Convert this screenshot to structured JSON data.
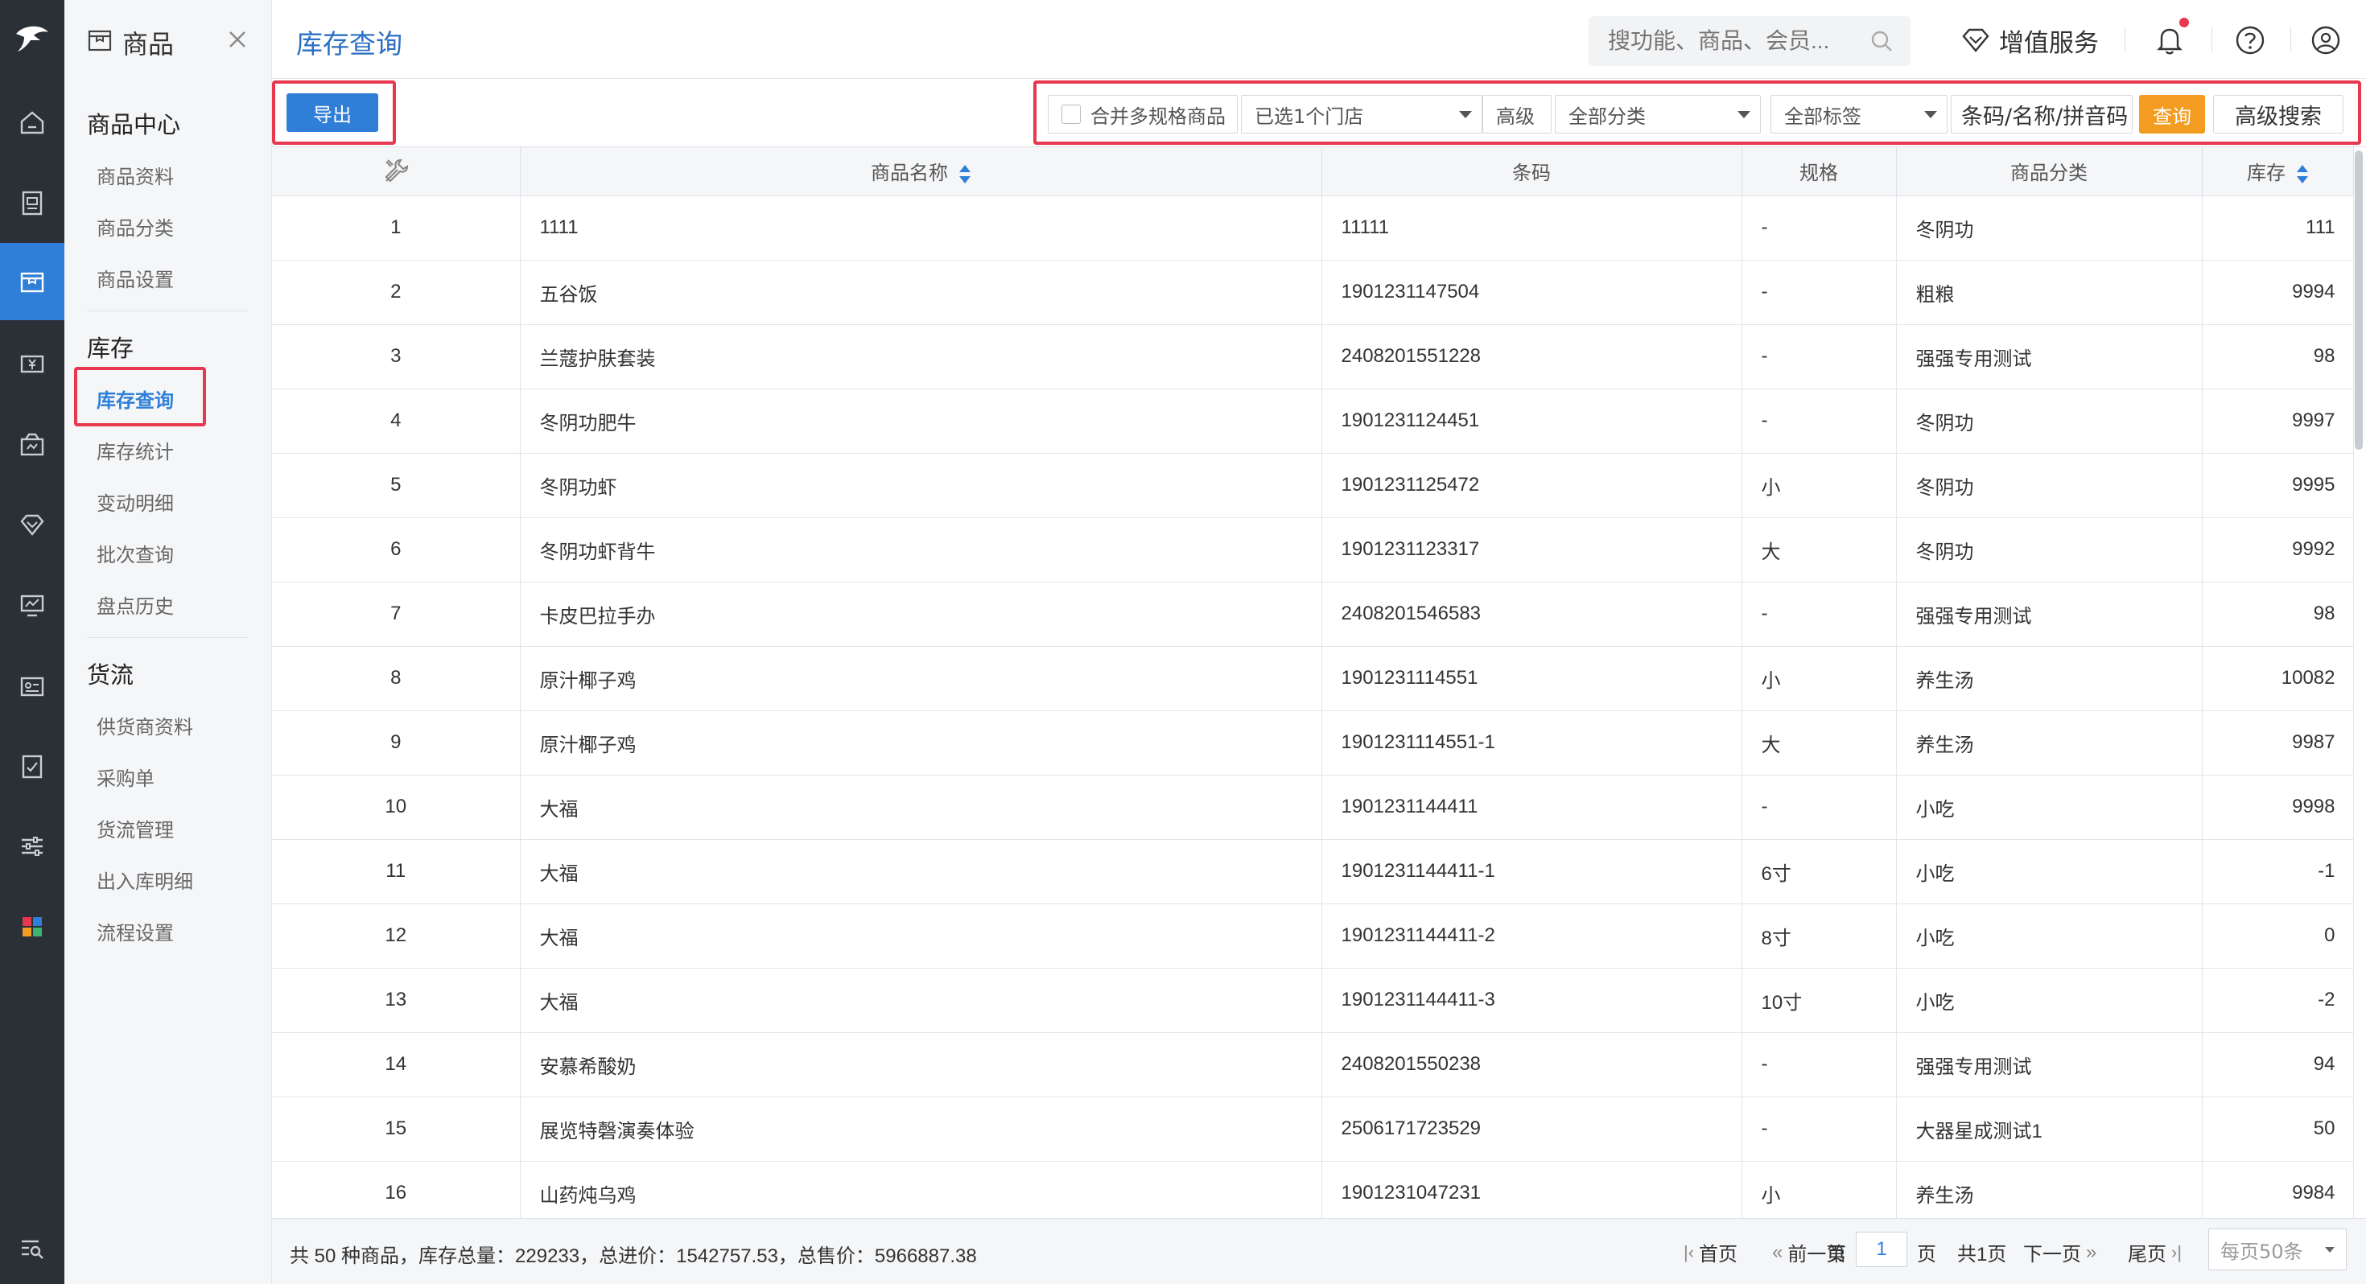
{
  "rail": {
    "items": [
      "home-icon",
      "ledger-icon",
      "product-icon",
      "cash-icon",
      "member-icon",
      "diamond-icon",
      "monitor-icon",
      "card-icon",
      "report-icon",
      "sliders-icon",
      "apps-icon"
    ],
    "active_index": 2,
    "bottom": "search-menu-icon"
  },
  "sidebar": {
    "title": "商品",
    "groups": [
      {
        "label": "商品中心",
        "items": [
          "商品资料",
          "商品分类",
          "商品设置"
        ]
      },
      {
        "label": "库存",
        "items": [
          "库存查询",
          "库存统计",
          "变动明细",
          "批次查询",
          "盘点历史"
        ]
      },
      {
        "label": "货流",
        "items": [
          "供货商资料",
          "采购单",
          "货流管理",
          "出入库明细",
          "流程设置"
        ]
      }
    ],
    "active_item": "库存查询"
  },
  "header": {
    "title": "库存查询",
    "search_placeholder": "搜功能、商品、会员...",
    "vip_label": "增值服务"
  },
  "toolbar": {
    "export_label": "导出",
    "merge_label": "合并多规格商品",
    "store_select": "已选1个门店",
    "advanced_label": "高级",
    "category_select": "全部分类",
    "tag_select": "全部标签",
    "code_search": "条码/名称/拼音码",
    "query_label": "查询",
    "advanced_search_label": "高级搜索"
  },
  "table": {
    "columns": [
      "",
      "商品名称",
      "条码",
      "规格",
      "商品分类",
      "库存"
    ],
    "rows": [
      [
        "1",
        "1111",
        "11111",
        "-",
        "冬阴功",
        "111"
      ],
      [
        "2",
        "五谷饭",
        "1901231147504",
        "-",
        "粗粮",
        "9994"
      ],
      [
        "3",
        "兰蔻护肤套装",
        "2408201551228",
        "-",
        "强强专用测试",
        "98"
      ],
      [
        "4",
        "冬阴功肥牛",
        "1901231124451",
        "-",
        "冬阴功",
        "9997"
      ],
      [
        "5",
        "冬阴功虾",
        "1901231125472",
        "小",
        "冬阴功",
        "9995"
      ],
      [
        "6",
        "冬阴功虾背牛",
        "1901231123317",
        "大",
        "冬阴功",
        "9992"
      ],
      [
        "7",
        "卡皮巴拉手办",
        "2408201546583",
        "-",
        "强强专用测试",
        "98"
      ],
      [
        "8",
        "原汁椰子鸡",
        "1901231114551",
        "小",
        "养生汤",
        "10082"
      ],
      [
        "9",
        "原汁椰子鸡",
        "1901231114551-1",
        "大",
        "养生汤",
        "9987"
      ],
      [
        "10",
        "大福",
        "1901231144411",
        "-",
        "小吃",
        "9998"
      ],
      [
        "11",
        "大福",
        "1901231144411-1",
        "6寸",
        "小吃",
        "-1"
      ],
      [
        "12",
        "大福",
        "1901231144411-2",
        "8寸",
        "小吃",
        "0"
      ],
      [
        "13",
        "大福",
        "1901231144411-3",
        "10寸",
        "小吃",
        "-2"
      ],
      [
        "14",
        "安慕希酸奶",
        "2408201550238",
        "-",
        "强强专用测试",
        "94"
      ],
      [
        "15",
        "展览特磬演奏体验",
        "2506171723529",
        "-",
        "大器星成测试1",
        "50"
      ],
      [
        "16",
        "山药炖乌鸡",
        "1901231047231",
        "小",
        "养生汤",
        "9984"
      ]
    ]
  },
  "footer": {
    "summary": "共 50 种商品，库存总量：229233，总进价：1542757.53，总售价：5966887.38",
    "first": "首页",
    "prev": "前一页",
    "page_prefix": "第",
    "page_value": "1",
    "page_suffix": "页",
    "total_pages": "共1页",
    "next": "下一页",
    "last": "尾页",
    "page_size": "每页50条"
  },
  "colors": {
    "accent": "#2f7ed8",
    "rail": "#2b2f36",
    "highlight": "#e8384f",
    "query": "#f39c21"
  }
}
